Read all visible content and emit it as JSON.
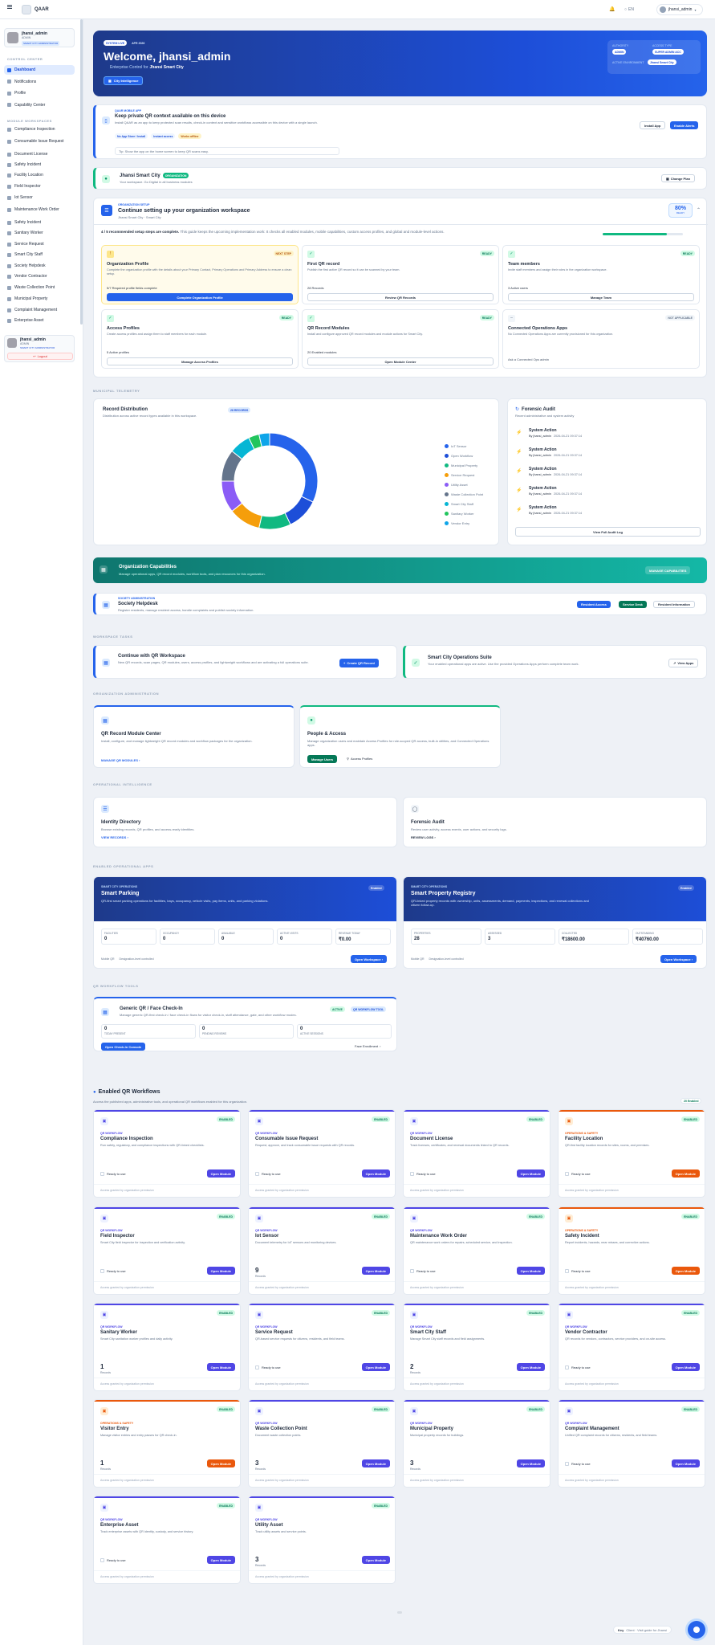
{
  "app": {
    "name": "QAAR",
    "lang": "EN",
    "user": "jhansi_admin"
  },
  "sidebar": {
    "user": {
      "name": "jhansi_admin",
      "role": "ADMIN",
      "badge": "SMART CITY ADMINISTRATOR"
    },
    "control_center": "CONTROL CENTER",
    "cc_items": [
      "Dashboard",
      "Notifications",
      "Profile",
      "Capability Center"
    ],
    "module_workspaces": "MODULE WORKSPACES",
    "modules": [
      "Compliance Inspection",
      "Consumable Issue Request",
      "Document License",
      "Safety Incident",
      "Facility Location",
      "Field Inspector",
      "Iot Sensor",
      "Maintenance Work Order",
      "Safety Incident",
      "Sanitary Worker",
      "Service Request",
      "Smart City Staff",
      "Society Helpdesk",
      "Vendor Contractor",
      "Waste Collection Point",
      "Municipal Property",
      "Complaint Management",
      "Enterprise Asset"
    ],
    "footer_user": {
      "name": "jhansi_admin",
      "role": "ADMIN",
      "badge": "SMART CITY ADMINISTRATOR"
    },
    "logout": "Logout"
  },
  "hero": {
    "badge1": "SYSTEM LIVE",
    "badge2": "APR 2026",
    "title": "Welcome, jhansi_admin",
    "subtitle": "Enterprise Control for",
    "subtitle_bold": "Jhansi Smart City",
    "button": "City Intelligence",
    "auth_label": "AUTHORITY",
    "auth_val": "ADMIN",
    "role_label": "ACCESS TYPE",
    "role_val": "SUPER ADMIN ACC",
    "env_label": "ACTIVE ENVIRONMENT",
    "env_val": "Jhansi Smart City"
  },
  "install": {
    "tag": "QAAR MOBILE APP",
    "title": "Keep private QR context available on this device",
    "desc": "Install QAAR as an app to keep protected scan results, check-in context and sensitive workflows accessible on this device with a single launch.",
    "chips": [
      "No App Store / Install",
      "Instant access",
      "Works offline"
    ],
    "note": "Tip: Show the app on the home screen to keep QR scans easy.",
    "btn1": "Install App",
    "btn2": "Enable Alerts"
  },
  "org": {
    "name": "Jhansi Smart City",
    "badge": "ORGANIZATION",
    "desc": "Your workspace. Go Digital in all business modules",
    "btn": "Change Plan"
  },
  "setup": {
    "tag": "ORGANIZATION SETUP",
    "title": "Continue setting up your organization workspace",
    "sub": "Jhansi Smart City · Smart City",
    "pct": "80%",
    "pct_label": "READY",
    "summary_bold": "4 / 5 recommended setup steps are complete.",
    "summary": "This guide keeps the upcoming implementation work: It checks all enabled modules, mobile capabilities, custom access profiles, and global and module-level actions.",
    "steps": [
      {
        "status": "NEXT STEP",
        "title": "Organization Profile",
        "desc": "Complete the organization profile with the details about your Primary Contact, Primary Operations and Primary Address to ensure a clean setup.",
        "meta": "5/7 Required profile fields complete",
        "btn": "Complete Organization Profile"
      },
      {
        "status": "READY",
        "title": "First QR record",
        "desc": "Publish the first active QR record so it can be scanned by your team.",
        "meta": "28 Records",
        "btn": "Review QR Records"
      },
      {
        "status": "READY",
        "title": "Team members",
        "desc": "Invite staff members and assign their roles in the organization workspace.",
        "meta": "3 Active users",
        "btn": "Manage Team"
      },
      {
        "status": "READY",
        "title": "Access Profiles",
        "desc": "Create access profiles and assign them to staff members for each module.",
        "meta": "5 Active profiles",
        "btn": "Manage Access Profiles"
      },
      {
        "status": "READY",
        "title": "QR Record Modules",
        "desc": "Install and configure approved QR record modules and module actions for Smart City.",
        "meta": "20 Enabled modules",
        "btn": "Open Module Center"
      },
      {
        "status": "NOT APPLICABLE",
        "title": "Connected Operations Apps",
        "desc": "No Connected Operations Apps are currently provisioned for this organization.",
        "meta": "",
        "btn": "Ask a Connected Ops admin"
      }
    ]
  },
  "telemetry": "MUNICIPAL TELEMETRY",
  "distribution": {
    "title": "Record Distribution",
    "sub": "Distribution across active record types available in this workspace.",
    "badge": "28 RECORDS",
    "legend": [
      "IoT Sensor",
      "Open Workflow",
      "Municipal Property",
      "Service Request",
      "Utility Asset",
      "Waste Collection Point",
      "Smart City Staff",
      "Sanitary Worker",
      "Vendor Entry"
    ]
  },
  "audit": {
    "title": "Forensic Audit",
    "sub": "Recent administrative and system activity",
    "rows": [
      {
        "title": "System Action",
        "by": "By jhansi_admin",
        "time": "2026-04-21 09:37:14"
      },
      {
        "title": "System Action",
        "by": "By jhansi_admin",
        "time": "2026-04-21 09:37:14"
      },
      {
        "title": "System Action",
        "by": "By jhansi_admin",
        "time": "2026-04-21 09:37:14"
      },
      {
        "title": "System Action",
        "by": "By jhansi_admin",
        "time": "2026-04-21 09:37:14"
      },
      {
        "title": "System Action",
        "by": "By jhansi_admin",
        "time": "2026-04-21 09:37:14"
      }
    ],
    "btn": "View Full Audit Log"
  },
  "capabilities": {
    "title": "Organization Capabilities",
    "desc": "Manage operational apps, QR record modules, workflow tools, and plan resources for this organization.",
    "btn": "MANAGE CAPABILITIES"
  },
  "helpdesk": {
    "tag": "SOCIETY ADMINISTRATION",
    "title": "Society Helpdesk",
    "desc": "Register residents, manage resident access, handle complaints and publish society information.",
    "btn1": "Resident Access",
    "btn2": "Service Desk",
    "btn3": "Resident Information"
  },
  "workspace_label": "WORKSPACE TASKS",
  "qr_workspace": {
    "title": "Continue with QR Workspace",
    "desc": "New QR records, scan pages, QR modules, users, access profiles, and lightweight workflows and are activating a full operations suite.",
    "btn": "Create QR Record"
  },
  "ops_suite": {
    "title": "Smart City Operations Suite",
    "desc": "Your enabled operational apps are active. Use the provided Operations Apps perform complete team work.",
    "btn": "View Apps"
  },
  "org_admin_label": "ORGANIZATION ADMINISTRATION",
  "module_center": {
    "title": "QR Record Module Center",
    "desc": "Install, configure, and manage lightweight QR record modules and workflow packages for the organization.",
    "link": "MANAGE QR MODULES"
  },
  "people": {
    "title": "People & Access",
    "desc": "Manage organization users and maintain Access Profiles for role-scoped QR access, built-in utilities, and Connected Operations apps.",
    "btn1": "Manage Users",
    "btn2": "Access Profiles"
  },
  "intel_label": "OPERATIONAL INTELLIGENCE",
  "identity": {
    "title": "Identity Directory",
    "desc": "Browse existing records, QR profiles, and access-ready identities.",
    "link": "VIEW RECORDS"
  },
  "forensic": {
    "title": "Forensic Audit",
    "desc": "Review user activity, access events, user actions, and security logs.",
    "link": "REVIEW LOGS"
  },
  "enabled_label": "ENABLED OPERATIONAL APPS",
  "parking": {
    "tag": "SMART CITY OPERATIONS",
    "title": "Smart Parking",
    "desc": "QR-first smart parking operations for facilities, bays, occupancy, vehicle visits, pay items, units, and parking violations.",
    "badge": "Enabled",
    "stats": [
      {
        "l": "FACILITIES",
        "v": "0"
      },
      {
        "l": "OCCUPANCY",
        "v": "0"
      },
      {
        "l": "AVAILABLE",
        "v": "0"
      },
      {
        "l": "ACTIVE VISITS",
        "v": "0"
      },
      {
        "l": "REVENUE TODAY",
        "v": "₹0.00"
      }
    ],
    "f1": "Mobile QR",
    "f2": "Designation-level controlled",
    "btn": "Open Workspace"
  },
  "property": {
    "tag": "SMART CITY OPERATIONS",
    "title": "Smart Property Registry",
    "desc": "QR-linked property records with ownership, units, assessments, demand, payments, inspections, and renewal collections and citizen follow-up.",
    "badge": "Enabled",
    "stats": [
      {
        "l": "PROPERTIES",
        "v": "28"
      },
      {
        "l": "ASSESSED",
        "v": "3"
      },
      {
        "l": "COLLECTED",
        "v": "₹18600.00"
      },
      {
        "l": "OUTSTANDING",
        "v": "₹40760.00"
      }
    ],
    "f1": "Mobile QR",
    "f2": "Designation-level controlled",
    "btn": "Open Workspace"
  },
  "qr_tools_label": "QR WORKFLOW TOOLS",
  "checkin": {
    "title": "Generic QR / Face Check-In",
    "desc": "Manage generic QR-first check-in / face check-in flows for visitor check-in, staff attendance, gate, and other workflow modes.",
    "b1": "ACTIVE",
    "b2": "QR WORKFLOW TOOL",
    "s": [
      {
        "v": "0",
        "l": "TODAY PRESENT"
      },
      {
        "v": "0",
        "l": "PENDING REVIEWS"
      },
      {
        "v": "0",
        "l": "ACTIVE SESSIONS"
      }
    ],
    "btn": "Open Check-In Console",
    "btn2": "Face Enrollment"
  },
  "workflows": {
    "title": "Enabled QR Workflows",
    "sub": "Access the published apps, administrative tools, and operational QR workflows enabled for this organization.",
    "badge": "20 Enabled",
    "cards": [
      {
        "cat": "QR WORKFLOW",
        "title": "Compliance Inspection",
        "desc": "Run safety, regulatory, and compliance inspections with QR-linked checklists.",
        "val": "",
        "val_l": "Ready to use",
        "btn": "Open Module",
        "orange": false
      },
      {
        "cat": "QR WORKFLOW",
        "title": "Consumable Issue Request",
        "desc": "Request, approve, and track consumable issue requests with QR records.",
        "val": "",
        "val_l": "Ready to use",
        "btn": "Open Module",
        "orange": false
      },
      {
        "cat": "QR WORKFLOW",
        "title": "Document License",
        "desc": "Track licenses, certificates, and renewal documents linked to QR records.",
        "val": "",
        "val_l": "Ready to use",
        "btn": "Open Module",
        "orange": false
      },
      {
        "cat": "OPERATIONS & SAFETY",
        "title": "Facility Location",
        "desc": "QR-first facility location records for sites, rooms, and premises.",
        "val": "",
        "val_l": "Ready to use",
        "btn": "Open Module",
        "orange": true
      },
      {
        "cat": "QR WORKFLOW",
        "title": "Field Inspector",
        "desc": "Smart City field inspector for inspection and verification activity.",
        "val": "",
        "val_l": "Ready to use",
        "btn": "Open Module",
        "orange": false
      },
      {
        "cat": "QR WORKFLOW",
        "title": "Iot Sensor",
        "desc": "Document telemetry for IoT sensors and monitoring devices.",
        "val": "9",
        "val_l": "Records",
        "btn": "Open Module",
        "orange": false
      },
      {
        "cat": "QR WORKFLOW",
        "title": "Maintenance Work Order",
        "desc": "QR maintenance work orders for repairs, scheduled service, and inspection.",
        "val": "",
        "val_l": "Ready to use",
        "btn": "Open Module",
        "orange": false
      },
      {
        "cat": "OPERATIONS & SAFETY",
        "title": "Safety Incident",
        "desc": "Report incidents, hazards, near misses, and corrective actions.",
        "val": "",
        "val_l": "Ready to use",
        "btn": "Open Module",
        "orange": true
      },
      {
        "cat": "QR WORKFLOW",
        "title": "Sanitary Worker",
        "desc": "Smart City sanitation worker profiles and daily activity.",
        "val": "1",
        "val_l": "Records",
        "btn": "Open Module",
        "orange": false
      },
      {
        "cat": "QR WORKFLOW",
        "title": "Service Request",
        "desc": "QR-based service requests for citizens, residents, and field teams.",
        "val": "",
        "val_l": "Ready to use",
        "btn": "Open Module",
        "orange": false
      },
      {
        "cat": "QR WORKFLOW",
        "title": "Smart City Staff",
        "desc": "Manage Smart City staff records and field assignments.",
        "val": "2",
        "val_l": "Records",
        "btn": "Open Module",
        "orange": false
      },
      {
        "cat": "QR WORKFLOW",
        "title": "Vendor Contractor",
        "desc": "QR records for vendors, contractors, service providers, and on-site access.",
        "val": "",
        "val_l": "Ready to use",
        "btn": "Open Module",
        "orange": false
      },
      {
        "cat": "OPERATIONS & SAFETY",
        "title": "Visitor Entry",
        "desc": "Manage visitor entries and entry passes for QR check-in.",
        "val": "1",
        "val_l": "Records",
        "btn": "Open Module",
        "orange": true
      },
      {
        "cat": "QR WORKFLOW",
        "title": "Waste Collection Point",
        "desc": "Document waste collection points.",
        "val": "3",
        "val_l": "Records",
        "btn": "Open Module",
        "orange": false
      },
      {
        "cat": "QR WORKFLOW",
        "title": "Municipal Property",
        "desc": "Municipal property records for buildings.",
        "val": "3",
        "val_l": "Records",
        "btn": "Open Module",
        "orange": false
      },
      {
        "cat": "QR WORKFLOW",
        "title": "Complaint Management",
        "desc": "Unified QR complaint records for citizens, residents, and field teams.",
        "val": "",
        "val_l": "Ready to use",
        "btn": "Open Module",
        "orange": false
      },
      {
        "cat": "QR WORKFLOW",
        "title": "Enterprise Asset",
        "desc": "Track enterprise assets with QR identity, custody, and service history.",
        "val": "",
        "val_l": "Ready to use",
        "btn": "Open Module",
        "orange": false
      },
      {
        "cat": "QR WORKFLOW",
        "title": "Utility Asset",
        "desc": "Track utility assets and service points.",
        "val": "3",
        "val_l": "Records",
        "btn": "Open Module",
        "orange": false
      }
    ],
    "enabled": "ENABLED",
    "footer": "Access granted by organization permission"
  },
  "bottom_bar": {
    "key": "Key",
    "text": "Client · Visit guide for Jhansi"
  }
}
